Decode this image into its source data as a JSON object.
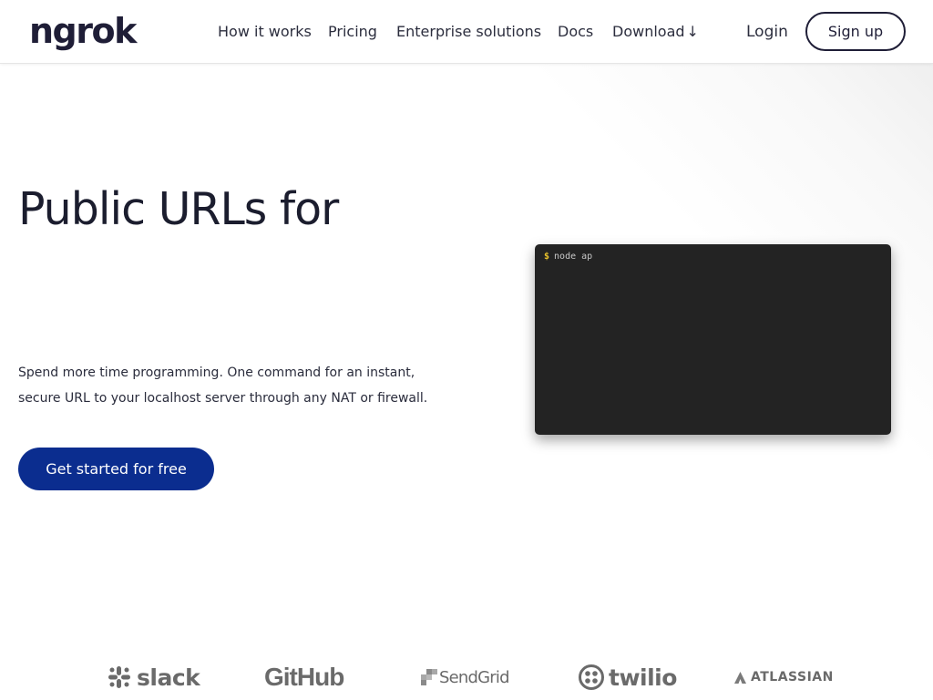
{
  "header": {
    "logo": "ngrok",
    "nav": [
      {
        "label": "How it works"
      },
      {
        "label": "Pricing"
      },
      {
        "label": "Enterprise solutions"
      },
      {
        "label": "Docs"
      },
      {
        "label": "Download",
        "arrow": "↓"
      }
    ],
    "login_label": "Login",
    "signup_label": "Sign up"
  },
  "hero": {
    "title": "Public URLs for",
    "description_line1": "Spend more time programming. One command for an instant,",
    "description_line2": "secure URL to your localhost server through any NAT or firewall.",
    "cta_label": "Get started for free"
  },
  "terminal": {
    "prompt": "$",
    "command": "node ap"
  },
  "logos": [
    {
      "name": "slack",
      "icon": "slack-icon"
    },
    {
      "name": "GitHub"
    },
    {
      "name": "SendGrid",
      "icon": "sendgrid-icon"
    },
    {
      "name": "twilio",
      "icon": "twilio-icon"
    },
    {
      "name": "ATLASSIAN",
      "icon": "atlassian-icon"
    }
  ],
  "colors": {
    "brand_dark": "#1f1e37",
    "cta_blue": "#0b2d8f",
    "terminal_bg": "#232323",
    "prompt_yellow": "#e8c12b",
    "logo_gray": "#6a6a6a"
  }
}
